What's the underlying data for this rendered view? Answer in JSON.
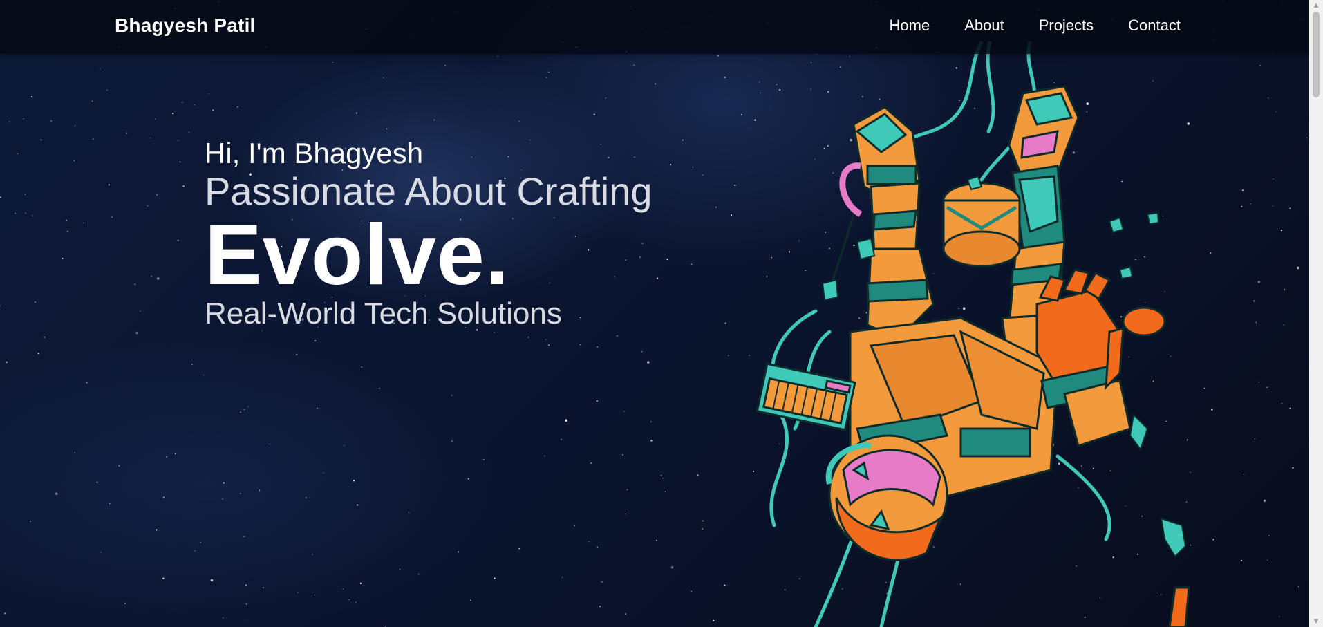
{
  "brand": "Bhagyesh Patil",
  "nav": [
    {
      "label": "Home"
    },
    {
      "label": "About"
    },
    {
      "label": "Projects"
    },
    {
      "label": "Contact"
    }
  ],
  "hero": {
    "greeting": "Hi, I'm Bhagyesh",
    "line1": "Passionate About Crafting",
    "headline": "Evolve.",
    "line2": "Real-World Tech Solutions"
  },
  "icons": {
    "illustration": "astronaut-illustration",
    "scroll_up": "scroll-up-arrow-icon",
    "scroll_down": "scroll-down-arrow-icon"
  },
  "colors": {
    "background": "#0b1326",
    "navbar": "#050914",
    "text": "#ffffff",
    "subtext": "#d9dbe2",
    "astronaut_orange": "#f39a3c",
    "astronaut_teal": "#3fc9b8"
  }
}
